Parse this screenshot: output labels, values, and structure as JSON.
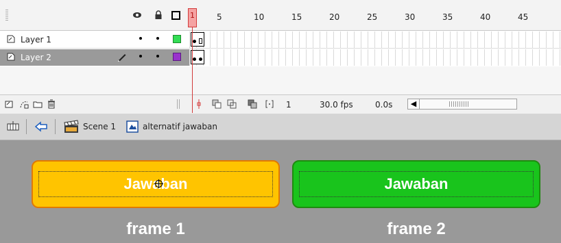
{
  "timeline": {
    "header_icons": [
      "eye-icon",
      "lock-icon",
      "outline-icon"
    ],
    "ruler": {
      "current_frame": "1",
      "ticks": [
        "5",
        "10",
        "15",
        "20",
        "25",
        "30",
        "35",
        "40",
        "45"
      ]
    },
    "layers": [
      {
        "name": "Layer 1",
        "color": "#33dd55",
        "selected": false
      },
      {
        "name": "Layer 2",
        "color": "#9933cc",
        "selected": true
      }
    ],
    "toolbar": {
      "current_frame": "1",
      "frame_rate": "30.0 fps",
      "elapsed_time": "0.0s"
    }
  },
  "edit_bar": {
    "scene_label": "Scene 1",
    "symbol_label": "alternatif jawaban"
  },
  "stage": {
    "buttons": [
      {
        "text": "Jawaban",
        "fill": "#ffc400",
        "border": "#e07a00"
      },
      {
        "text": "Jawaban",
        "fill": "#19c41c",
        "border": "#1f8a10"
      }
    ],
    "frame_labels": [
      "frame 1",
      "frame 2"
    ]
  }
}
